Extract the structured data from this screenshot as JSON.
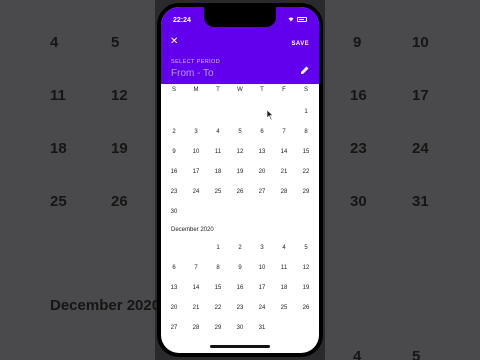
{
  "status": {
    "time": "22:24"
  },
  "header": {
    "close_icon": "close-icon",
    "save_label": "SAVE",
    "select_label": "SELECT PERIOD",
    "range_placeholder": "From - To",
    "edit_icon": "pencil-icon",
    "accent_color": "#6200ee"
  },
  "weekdays": [
    "S",
    "M",
    "T",
    "W",
    "T",
    "F",
    "S"
  ],
  "november": {
    "days": [
      "1",
      "2",
      "3",
      "4",
      "5",
      "6",
      "7",
      "8",
      "9",
      "10",
      "11",
      "12",
      "13",
      "14",
      "15",
      "16",
      "17",
      "18",
      "19",
      "20",
      "21",
      "22",
      "23",
      "24",
      "25",
      "26",
      "27",
      "28",
      "29",
      "30"
    ]
  },
  "december": {
    "title": "December 2020",
    "days": [
      "1",
      "2",
      "3",
      "4",
      "5",
      "6",
      "7",
      "8",
      "9",
      "10",
      "11",
      "12",
      "13",
      "14",
      "15",
      "16",
      "17",
      "18",
      "19",
      "20",
      "21",
      "22",
      "23",
      "24",
      "25",
      "26",
      "27",
      "28",
      "29",
      "30",
      "31"
    ]
  },
  "background": {
    "numbers_left": [
      "4",
      "5",
      "11",
      "12",
      "18",
      "19",
      "25",
      "26"
    ],
    "numbers_right": [
      "9",
      "10",
      "16",
      "17",
      "23",
      "24",
      "30",
      "31"
    ],
    "title_left": "December 2020",
    "numbers_bottom_right": [
      "4",
      "5"
    ]
  }
}
